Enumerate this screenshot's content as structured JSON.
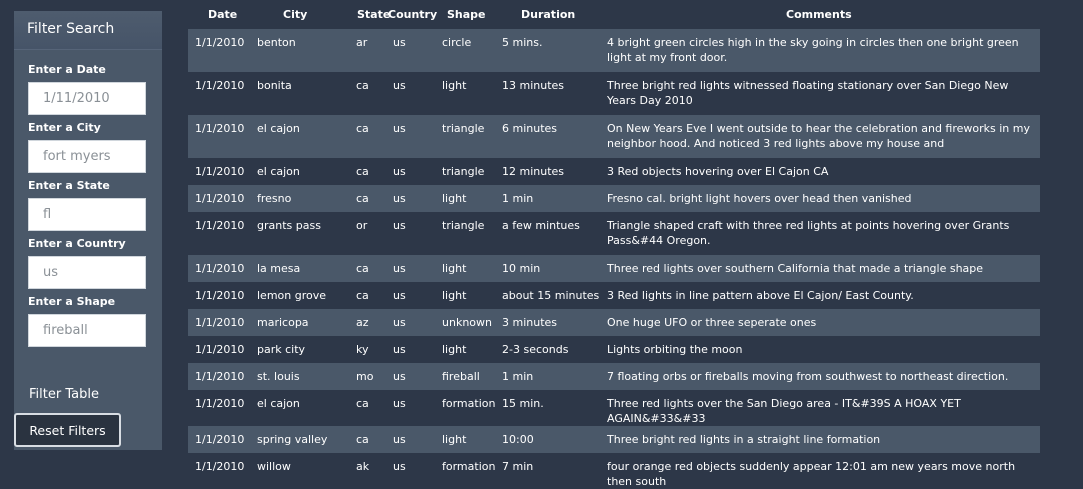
{
  "sidebar": {
    "title": "Filter Search",
    "filters": [
      {
        "label": "Enter a Date",
        "placeholder": "1/11/2010"
      },
      {
        "label": "Enter a City",
        "placeholder": "fort myers"
      },
      {
        "label": "Enter a State",
        "placeholder": "fl"
      },
      {
        "label": "Enter a Country",
        "placeholder": "us"
      },
      {
        "label": "Enter a Shape",
        "placeholder": "fireball"
      }
    ],
    "filter_table_label": "Filter Table",
    "reset_label": "Reset Filters"
  },
  "table": {
    "headers": [
      "Date",
      "City",
      "State",
      "Country",
      "Shape",
      "Duration",
      "Comments"
    ],
    "rows": [
      [
        "1/1/2010",
        "benton",
        "ar",
        "us",
        "circle",
        "5 mins.",
        "4 bright green circles high in the sky going in circles then one bright green light at my front door."
      ],
      [
        "1/1/2010",
        "bonita",
        "ca",
        "us",
        "light",
        "13 minutes",
        "Three bright red lights witnessed floating stationary over San Diego New Years Day 2010"
      ],
      [
        "1/1/2010",
        "el cajon",
        "ca",
        "us",
        "triangle",
        "6 minutes",
        "On New Years Eve I went outside to hear the celebration and fireworks in my neighbor hood. And noticed 3 red lights above my house and"
      ],
      [
        "1/1/2010",
        "el cajon",
        "ca",
        "us",
        "triangle",
        "12 minutes",
        "3 Red objects hovering over El Cajon CA"
      ],
      [
        "1/1/2010",
        "fresno",
        "ca",
        "us",
        "light",
        "1 min",
        "Fresno cal. bright light hovers over head then vanished"
      ],
      [
        "1/1/2010",
        "grants pass",
        "or",
        "us",
        "triangle",
        "a few mintues",
        "Triangle shaped craft with three red lights at points hovering over Grants Pass&#44 Oregon."
      ],
      [
        "1/1/2010",
        "la mesa",
        "ca",
        "us",
        "light",
        "10 min",
        "Three red lights over southern California that made a triangle shape"
      ],
      [
        "1/1/2010",
        "lemon grove",
        "ca",
        "us",
        "light",
        "about 15 minutes",
        "3 Red lights in line pattern above El Cajon/ East County."
      ],
      [
        "1/1/2010",
        "maricopa",
        "az",
        "us",
        "unknown",
        "3 minutes",
        "One huge UFO or three seperate ones"
      ],
      [
        "1/1/2010",
        "park city",
        "ky",
        "us",
        "light",
        "2-3 seconds",
        "Lights orbiting the moon"
      ],
      [
        "1/1/2010",
        "st. louis",
        "mo",
        "us",
        "fireball",
        "1 min",
        "7 floating orbs or fireballs moving from southwest to northeast direction."
      ],
      [
        "1/1/2010",
        "el cajon",
        "ca",
        "us",
        "formation",
        "15 min.",
        "Three red lights over the San Diego area - IT&#39S A HOAX YET AGAIN&#33&#33"
      ],
      [
        "1/1/2010",
        "spring valley",
        "ca",
        "us",
        "light",
        "10:00",
        "Three bright red lights in a straight line formation"
      ],
      [
        "1/1/2010",
        "willow",
        "ak",
        "us",
        "formation",
        "7 min",
        "four orange red objects suddenly appear 12:01 am new years move north then south"
      ]
    ]
  }
}
